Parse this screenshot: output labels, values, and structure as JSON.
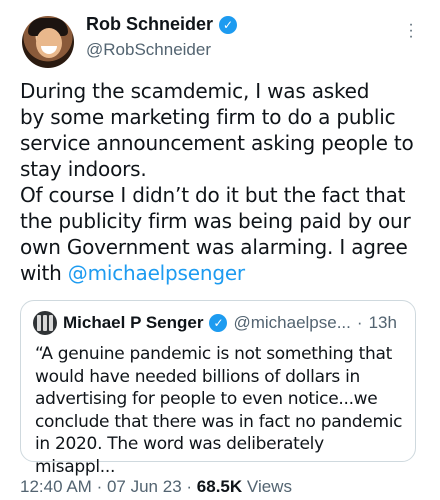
{
  "author": {
    "display_name": "Rob Schneider",
    "handle": "@RobSchneider"
  },
  "tweet": {
    "text_before_mention": "During the scamdemic, I was asked\nby some marketing firm to do a public\nservice announcement asking people to\nstay indoors.\nOf course I didn’t do it but the fact that\nthe publicity firm was being paid by our\nown Government was alarming. I agree\nwith ",
    "mention": "@michaelpsenger"
  },
  "quoted": {
    "display_name": "Michael P Senger",
    "handle": "@michaelpse...",
    "separator": "·",
    "time": "13h",
    "text": "“A genuine pandemic is not something that\nwould have needed billions of dollars in\nadvertising for people to even notice...we\nconclude that there was in fact no pandemic\nin 2020. The word was deliberately misappl..."
  },
  "meta": {
    "time": "12:40 AM",
    "date": "07 Jun 23",
    "separator": "·",
    "views_count": "68.5K",
    "views_label": "Views"
  },
  "icons": {
    "verified": "verified-badge-icon",
    "more": "more-vertical-icon"
  },
  "colors": {
    "accent": "#1d9bf0",
    "secondary_text": "#536471",
    "border": "#cfd9de"
  }
}
